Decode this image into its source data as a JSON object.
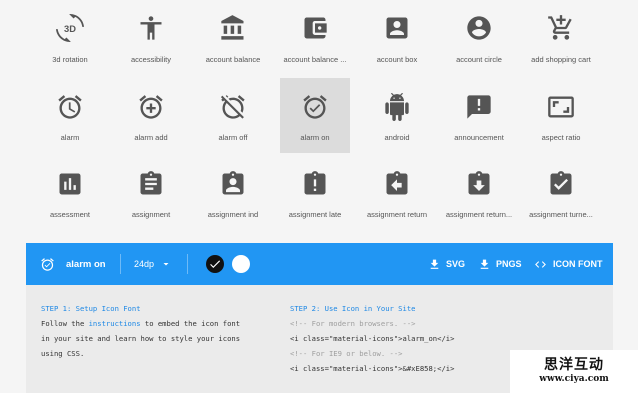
{
  "icons": [
    {
      "name": "3d-rotation-icon",
      "label": "3d rotation"
    },
    {
      "name": "accessibility-icon",
      "label": "accessibility"
    },
    {
      "name": "account-balance-icon",
      "label": "account balance"
    },
    {
      "name": "account-balance-wallet-icon",
      "label": "account balance ..."
    },
    {
      "name": "account-box-icon",
      "label": "account box"
    },
    {
      "name": "account-circle-icon",
      "label": "account circle"
    },
    {
      "name": "add-shopping-cart-icon",
      "label": "add shopping cart"
    },
    {
      "name": "alarm-icon",
      "label": "alarm"
    },
    {
      "name": "alarm-add-icon",
      "label": "alarm add"
    },
    {
      "name": "alarm-off-icon",
      "label": "alarm off"
    },
    {
      "name": "alarm-on-icon",
      "label": "alarm on"
    },
    {
      "name": "android-icon",
      "label": "android"
    },
    {
      "name": "announcement-icon",
      "label": "announcement"
    },
    {
      "name": "aspect-ratio-icon",
      "label": "aspect ratio"
    },
    {
      "name": "assessment-icon",
      "label": "assessment"
    },
    {
      "name": "assignment-icon",
      "label": "assignment"
    },
    {
      "name": "assignment-ind-icon",
      "label": "assignment ind"
    },
    {
      "name": "assignment-late-icon",
      "label": "assignment late"
    },
    {
      "name": "assignment-return-icon",
      "label": "assignment return"
    },
    {
      "name": "assignment-returned-icon",
      "label": "assignment return..."
    },
    {
      "name": "assignment-turned-in-icon",
      "label": "assignment turne..."
    }
  ],
  "toolbar": {
    "selected_icon": "alarm on",
    "size": "24dp",
    "svg_label": "SVG",
    "pngs_label": "PNGS",
    "iconfont_label": "ICON FONT",
    "colors": [
      "#000000",
      "#ffffff"
    ]
  },
  "step1": {
    "title": "STEP 1: Setup Icon Font",
    "text_a": "Follow the ",
    "link": "instructions",
    "text_b": " to embed the icon font",
    "line2": "in your site and learn how to style your icons",
    "line3": "using CSS."
  },
  "step2": {
    "title": "STEP 2: Use Icon in Your Site",
    "c1": "<!-- For modern browsers. -->",
    "code1": "<i class=\"material-icons\">alarm_on</i>",
    "c2": "<!-- For IE9 or below. -->",
    "code2": "<i class=\"material-icons\">&#xE858;</i>"
  },
  "watermark": {
    "cn": "思洋互动",
    "url": "www.ciya.com"
  },
  "accent": "#2196f3"
}
